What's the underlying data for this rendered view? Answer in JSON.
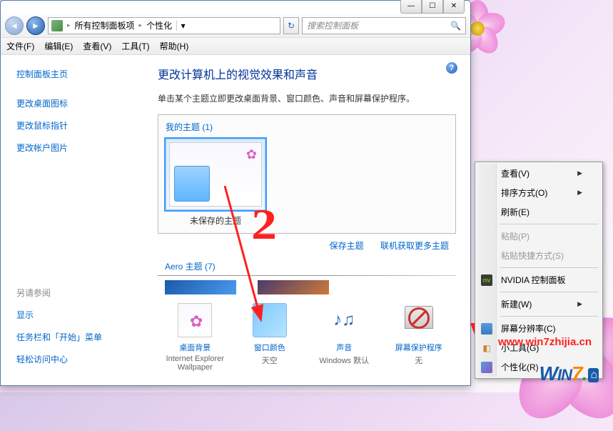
{
  "window": {
    "title_controls": {
      "min": "—",
      "max": "☐",
      "close": "✕"
    }
  },
  "nav": {
    "back": "◄",
    "fwd": "►",
    "breadcrumb": {
      "root": "所有控制面板项",
      "current": "个性化",
      "sep": "▸",
      "drop": "▾"
    },
    "refresh": "↻"
  },
  "search": {
    "placeholder": "搜索控制面板",
    "icon": "🔍"
  },
  "menu": {
    "file": "文件(F)",
    "edit": "编辑(E)",
    "view": "查看(V)",
    "tools": "工具(T)",
    "help": "帮助(H)"
  },
  "sidebar": {
    "home": "控制面板主页",
    "links": [
      "更改桌面图标",
      "更改鼠标指针",
      "更改帐户图片"
    ],
    "see_also_hdr": "另请参阅",
    "see_also": [
      "显示",
      "任务栏和「开始」菜单",
      "轻松访问中心"
    ]
  },
  "main": {
    "title": "更改计算机上的视觉效果和声音",
    "subtitle": "单击某个主题立即更改桌面背景、窗口颜色、声音和屏幕保护程序。",
    "help": "?",
    "my_themes_hdr": "我的主题 (1)",
    "unsaved_theme": "未保存的主题",
    "save_link": "保存主题",
    "online_link": "联机获取更多主题",
    "aero_hdr": "Aero 主题 (7)"
  },
  "bottom": {
    "bg": {
      "label": "桌面背景",
      "sub": "Internet Explorer Wallpaper"
    },
    "color": {
      "label": "窗口颜色",
      "sub": "天空"
    },
    "sound": {
      "label": "声音",
      "sub": "Windows 默认"
    },
    "saver": {
      "label": "屏幕保护程序",
      "sub": "无"
    }
  },
  "ctx": {
    "view": "查看(V)",
    "sort": "排序方式(O)",
    "refresh": "刷新(E)",
    "paste": "粘贴(P)",
    "paste_shortcut": "粘贴快捷方式(S)",
    "nvidia": "NVIDIA 控制面板",
    "new": "新建(W)",
    "screen_res": "屏幕分辨率(C)",
    "gadgets": "小工具(G)",
    "personalize": "个性化(R)"
  },
  "watermark": "www.win7zhijia.cn"
}
